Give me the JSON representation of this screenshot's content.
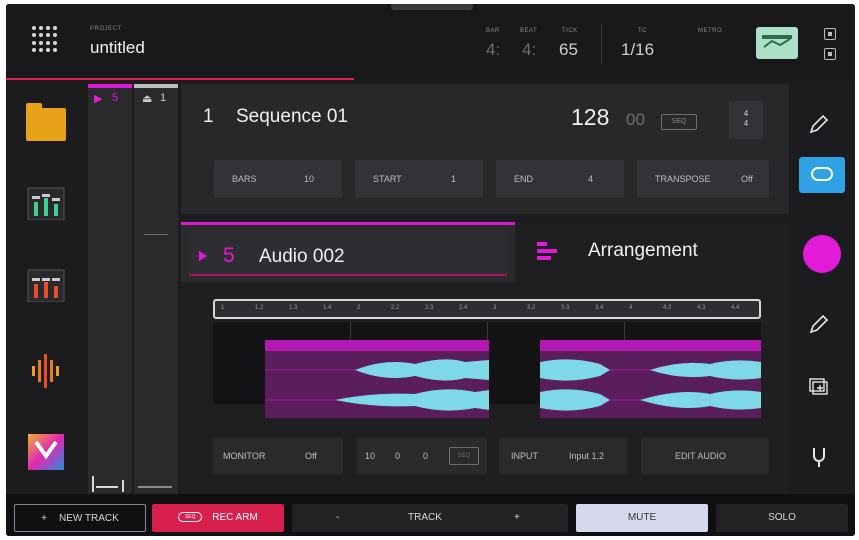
{
  "header": {
    "project_label": "PROJECT",
    "project_name": "untitled",
    "bar_label": "BAR",
    "beat_label": "BEAT",
    "tick_label": "TICK",
    "tc_label": "TC",
    "metro_label": "METRO",
    "bar_value": "4:",
    "beat_value": "4:",
    "tick_value": "65",
    "tc_value": "1/16"
  },
  "sidebar": {
    "items": [
      {
        "name": "browser-icon"
      },
      {
        "name": "mixer-icon"
      },
      {
        "name": "channel-mixer-icon"
      },
      {
        "name": "sample-edit-icon"
      },
      {
        "name": "plugin-icon"
      }
    ]
  },
  "strips": {
    "left_label": "5",
    "right_label": "1"
  },
  "sequence": {
    "number": "1",
    "name": "Sequence 01",
    "bpm": "128",
    "bpm_decimal": "00",
    "seq_chip": "SEQ",
    "time_sig_top": "4",
    "time_sig_bottom": "4",
    "fields": [
      {
        "label": "BARS",
        "value": "10"
      },
      {
        "label": "START",
        "value": "1"
      },
      {
        "label": "END",
        "value": "4"
      },
      {
        "label": "TRANSPOSE",
        "value": "Off"
      }
    ]
  },
  "track": {
    "number": "5",
    "name": "Audio 002"
  },
  "arrangement": {
    "label": "Arrangement"
  },
  "timeline": {
    "ticks": [
      "1",
      "1.2",
      "1.3",
      "1.4",
      "2",
      "2.2",
      "2.3",
      "2.4",
      "3",
      "3.2",
      "3.3",
      "3.4",
      "4",
      "4.2",
      "4.3",
      "4.4"
    ]
  },
  "editor_fields": {
    "monitor_label": "MONITOR",
    "monitor_value": "Off",
    "pos_a": "10",
    "pos_b": "0",
    "pos_c": "0",
    "pos_chip": "SEQ",
    "input_label": "INPUT",
    "input_value": "Input 1,2",
    "edit_audio": "EDIT AUDIO"
  },
  "bottom": {
    "new_track": "NEW TRACK",
    "new_track_plus": "+",
    "rec_chip": "SEQ",
    "rec_arm": "REC ARM",
    "minus": "-",
    "track": "TRACK",
    "plus": "+",
    "mute": "MUTE",
    "solo": "SOLO"
  },
  "colors": {
    "accent_magenta": "#e21bd9",
    "accent_red": "#d8204f",
    "accent_blue": "#2ea2e5",
    "waveform": "#7fd8e8"
  }
}
